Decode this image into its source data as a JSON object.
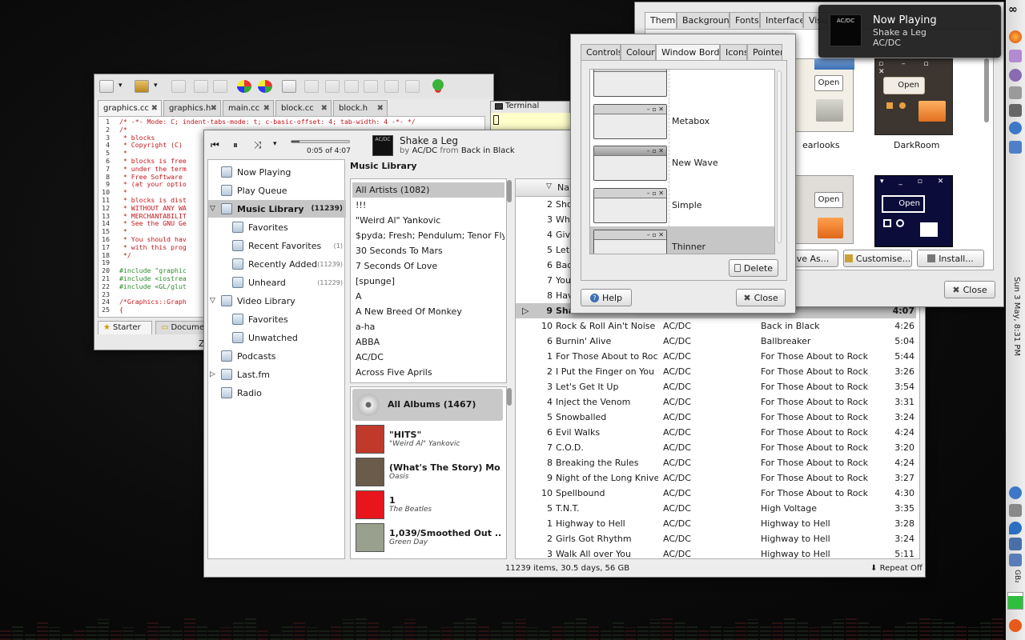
{
  "colors": {
    "selection": "#c6c6c6",
    "desktop": "#0d0d0d",
    "editor_comment": "#c4161c",
    "editor_include": "#2c8a2c"
  },
  "editor": {
    "tabs": [
      "graphics.cc",
      "graphics.h",
      "main.cc",
      "block.cc",
      "block.h"
    ],
    "terminal_label": "Terminal",
    "lines": [
      {
        "n": "1",
        "t": "/* -*- Mode: C; indent-tabs-mode: t; c-basic-offset: 4; tab-width: 4 -*- */"
      },
      {
        "n": "2",
        "t": "/*"
      },
      {
        "n": "3",
        "t": " * blocks"
      },
      {
        "n": "4",
        "t": " * Copyright (C)"
      },
      {
        "n": "5",
        "t": " *"
      },
      {
        "n": "6",
        "t": " * blocks is free"
      },
      {
        "n": "7",
        "t": " * under the term"
      },
      {
        "n": "8",
        "t": " * Free Software"
      },
      {
        "n": "9",
        "t": " * (at your optio"
      },
      {
        "n": "10",
        "t": " *"
      },
      {
        "n": "11",
        "t": " * blocks is dist"
      },
      {
        "n": "12",
        "t": " * WITHOUT ANY WA"
      },
      {
        "n": "13",
        "t": " * MERCHANTABILIT"
      },
      {
        "n": "14",
        "t": " * See the GNU Ge"
      },
      {
        "n": "15",
        "t": " *"
      },
      {
        "n": "16",
        "t": " * You should hav"
      },
      {
        "n": "17",
        "t": " * with this prog"
      },
      {
        "n": "18",
        "t": " */"
      },
      {
        "n": "19",
        "t": ""
      },
      {
        "n": "20",
        "t": "#include \"graphic"
      },
      {
        "n": "21",
        "t": "#include <iostrea"
      },
      {
        "n": "22",
        "t": "#include <GL/glut"
      },
      {
        "n": "23",
        "t": ""
      },
      {
        "n": "24",
        "t": "/*Graphics::Graph"
      },
      {
        "n": "25",
        "t": "{"
      }
    ],
    "bottom_tabs": [
      "Starter",
      "Documen"
    ],
    "status_fragment": "Z"
  },
  "player": {
    "time": "0:05 of 4:07",
    "track_title": "Shake a Leg",
    "by_word": "by",
    "artist": "AC/DC",
    "from_word": "from",
    "album": "Back in Black",
    "sidebar": [
      {
        "label": "Now Playing",
        "count": "",
        "indent": false,
        "bold": false
      },
      {
        "label": "Play Queue",
        "count": "",
        "indent": false,
        "bold": false
      },
      {
        "label": "Music Library",
        "count": "(11239)",
        "indent": false,
        "bold": true,
        "expander": "▽"
      },
      {
        "label": "Favorites",
        "count": "",
        "indent": true,
        "bold": false
      },
      {
        "label": "Recent Favorites",
        "count": "(1)",
        "indent": true,
        "bold": false
      },
      {
        "label": "Recently Added",
        "count": "(11239)",
        "indent": true,
        "bold": false
      },
      {
        "label": "Unheard",
        "count": "(11229)",
        "indent": true,
        "bold": false
      },
      {
        "label": "Video Library",
        "count": "",
        "indent": false,
        "bold": false,
        "expander": "▽"
      },
      {
        "label": "Favorites",
        "count": "",
        "indent": true,
        "bold": false
      },
      {
        "label": "Unwatched",
        "count": "",
        "indent": true,
        "bold": false
      },
      {
        "label": "Podcasts",
        "count": "",
        "indent": false,
        "bold": false
      },
      {
        "label": "Last.fm",
        "count": "",
        "indent": false,
        "bold": false,
        "expander": "▷"
      },
      {
        "label": "Radio",
        "count": "",
        "indent": false,
        "bold": false
      }
    ],
    "library_heading": "Music Library",
    "artists": [
      "All Artists (1082)",
      "!!!",
      "\"Weird Al\" Yankovic",
      "$pyda; Fresh; Pendulum; Tenor Fly",
      "30 Seconds To Mars",
      "7 Seconds Of Love",
      "[spunge]",
      "A",
      "A New Breed Of Monkey",
      "a-ha",
      "ABBA",
      "AC/DC",
      "Across Five Aprils"
    ],
    "albums_header": "All Albums (1467)",
    "albums": [
      {
        "title": "\"HITS\"",
        "artist": "\"Weird Al\" Yankovic",
        "color": "#c0392b"
      },
      {
        "title": "(What's The Story) Mo...",
        "artist": "Oasis",
        "color": "#6b5b4b"
      },
      {
        "title": "1",
        "artist": "The Beatles",
        "color": "#e8161c"
      },
      {
        "title": "1,039/Smoothed Out ...",
        "artist": "Green Day",
        "color": "#9aa08e"
      }
    ],
    "columns": {
      "name_header": "Nar"
    },
    "tracks": [
      {
        "n": "2",
        "title": "Sho",
        "artist": "",
        "album": "",
        "dur": ""
      },
      {
        "n": "3",
        "title": "Wha",
        "artist": "",
        "album": "",
        "dur": ""
      },
      {
        "n": "4",
        "title": "Giv",
        "artist": "",
        "album": "",
        "dur": ""
      },
      {
        "n": "5",
        "title": "Let",
        "artist": "",
        "album": "",
        "dur": ""
      },
      {
        "n": "6",
        "title": "Bac",
        "artist": "",
        "album": "",
        "dur": ""
      },
      {
        "n": "7",
        "title": "You",
        "artist": "",
        "album": "",
        "dur": ""
      },
      {
        "n": "8",
        "title": "Hav",
        "artist": "",
        "album": "",
        "dur": ""
      },
      {
        "n": "9",
        "title": "Sha",
        "artist": "",
        "album": "Black",
        "dur": "4:07",
        "playing": true
      },
      {
        "n": "10",
        "title": "Rock & Roll Ain't Noise P...",
        "artist": "AC/DC",
        "album": "Back in Black",
        "dur": "4:26"
      },
      {
        "n": "6",
        "title": "Burnin' Alive",
        "artist": "AC/DC",
        "album": "Ballbreaker",
        "dur": "5:04"
      },
      {
        "n": "1",
        "title": "For Those About to Rock...",
        "artist": "AC/DC",
        "album": "For Those About to Rock ...",
        "dur": "5:44"
      },
      {
        "n": "2",
        "title": "I Put the Finger on You",
        "artist": "AC/DC",
        "album": "For Those About to Rock ...",
        "dur": "3:26"
      },
      {
        "n": "3",
        "title": "Let's Get It Up",
        "artist": "AC/DC",
        "album": "For Those About to Rock ...",
        "dur": "3:54"
      },
      {
        "n": "4",
        "title": "Inject the Venom",
        "artist": "AC/DC",
        "album": "For Those About to Rock ...",
        "dur": "3:31"
      },
      {
        "n": "5",
        "title": "Snowballed",
        "artist": "AC/DC",
        "album": "For Those About to Rock ...",
        "dur": "3:24"
      },
      {
        "n": "6",
        "title": "Evil Walks",
        "artist": "AC/DC",
        "album": "For Those About to Rock ...",
        "dur": "4:24"
      },
      {
        "n": "7",
        "title": "C.O.D.",
        "artist": "AC/DC",
        "album": "For Those About to Rock ...",
        "dur": "3:20"
      },
      {
        "n": "8",
        "title": "Breaking the Rules",
        "artist": "AC/DC",
        "album": "For Those About to Rock ...",
        "dur": "4:24"
      },
      {
        "n": "9",
        "title": "Night of the Long Knives",
        "artist": "AC/DC",
        "album": "For Those About to Rock ...",
        "dur": "3:27"
      },
      {
        "n": "10",
        "title": "Spellbound",
        "artist": "AC/DC",
        "album": "For Those About to Rock ...",
        "dur": "4:30"
      },
      {
        "n": "5",
        "title": "T.N.T.",
        "artist": "AC/DC",
        "album": "High Voltage",
        "dur": "3:35"
      },
      {
        "n": "1",
        "title": "Highway to Hell",
        "artist": "AC/DC",
        "album": "Highway to Hell",
        "dur": "3:28"
      },
      {
        "n": "2",
        "title": "Girls Got Rhythm",
        "artist": "AC/DC",
        "album": "Highway to Hell",
        "dur": "3:24"
      },
      {
        "n": "3",
        "title": "Walk All over You",
        "artist": "AC/DC",
        "album": "Highway to Hell",
        "dur": "5:11"
      }
    ],
    "status": "11239 items, 30.5 days, 56 GB",
    "repeat": "Repeat Off"
  },
  "appearance": {
    "tabs": [
      "Theme",
      "Background",
      "Fonts",
      "Interface",
      "Visua"
    ],
    "themes": [
      {
        "label": "earlooks"
      },
      {
        "label": "DarkRoom"
      }
    ],
    "open_label": "Open",
    "save_as": "ve As...",
    "customise": "Customise...",
    "install": "Install...",
    "close": "Close"
  },
  "theme_details": {
    "tabs": [
      "Controls",
      "Colours",
      "Window Border",
      "Icons",
      "Pointer"
    ],
    "borders": [
      {
        "label": ""
      },
      {
        "label": "Metabox"
      },
      {
        "label": "New Wave"
      },
      {
        "label": "Simple"
      },
      {
        "label": "Thinner",
        "selected": true
      }
    ],
    "delete": "Delete",
    "help": "Help",
    "close": "Close"
  },
  "notification": {
    "title": "Now Playing",
    "track": "Shake a Leg",
    "artist": "AC/DC",
    "cover_text": "AC/DC"
  },
  "panel": {
    "clock": "Sun 3 May,  8:31 PM",
    "net": "GB₂"
  }
}
